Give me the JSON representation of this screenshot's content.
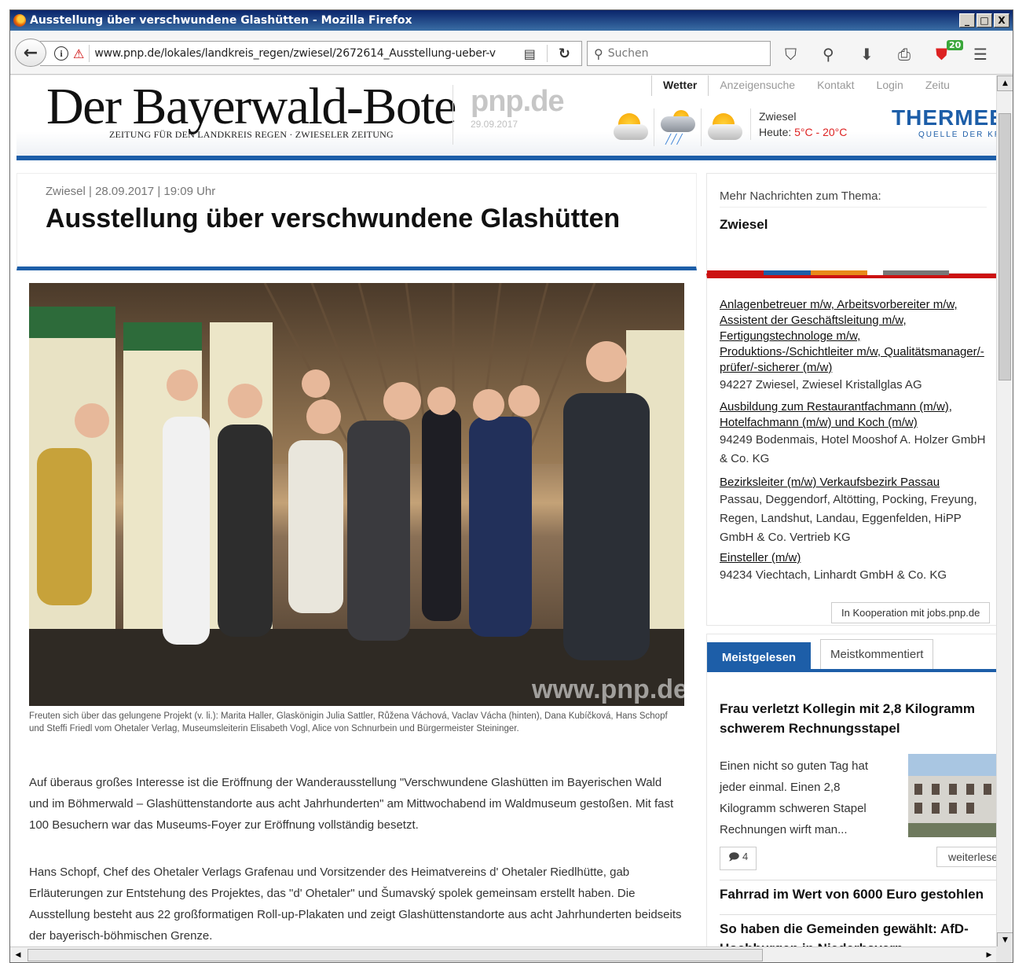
{
  "window": {
    "title": "Ausstellung über verschwundene Glashütten - Mozilla Firefox",
    "controls": [
      "_",
      "□",
      "X"
    ]
  },
  "navbar": {
    "url": "www.pnp.de/lokales/landkreis_regen/zwiesel/2672614_Ausstellung-ueber-v",
    "search_placeholder": "Suchen",
    "addon_badge": "20"
  },
  "site": {
    "logo": "Der Bayerwald-Bote",
    "logo_sub": "ZEITUNG FÜR DEN LANDKREIS REGEN · ZWIESELER ZEITUNG",
    "pnp": "pnp.de",
    "pnp_date": "29.09.2017",
    "top_tabs": [
      "Wetter",
      "Anzeigensuche",
      "Kontakt",
      "Login",
      "Zeitu"
    ],
    "weather": {
      "place": "Zwiesel",
      "today_label": "Heute: ",
      "min": "5°C",
      "dash": " - ",
      "max": "20°C",
      "icons": [
        "sun-cloud-icon",
        "rain-cloud-icon",
        "sun-cloud-icon"
      ]
    },
    "ad": {
      "brand": "THERMEE",
      "tagline": "QUELLE DER KRA"
    }
  },
  "article": {
    "meta": "Zwiesel  |  28.09.2017  |  19:09 Uhr",
    "headline": "Ausstellung über verschwundene Glashütten",
    "photo_watermark": "www.pnp.de",
    "caption": "Freuten sich über das gelungene Projekt (v. li.): Marita Haller, Glaskönigin Julia Sattler, Růžena Váchová, Vaclav Vácha (hinten), Dana Kubíčková, Hans Schopf und Steffi Friedl vom Ohetaler Verlag, Museumsleiterin Elisabeth Vogl, Alice von Schnurbein und Bürgermeister Steininger.",
    "paragraphs": [
      "Auf überaus großes Interesse ist die Eröffnung der Wanderausstellung \"Verschwundene Glashütten im Bayerischen Wald und im Böhmerwald – Glashüttenstandorte aus acht Jahrhunderten\" am Mittwochabend im Waldmuseum gestoßen. Mit fast 100 Besuchern war das Museums-Foyer zur Eröffnung vollständig besetzt.",
      "Hans Schopf, Chef des Ohetaler Verlags Grafenau und Vorsitzender des Heimatvereins d' Ohetaler Riedlhütte, gab Erläuterungen zur Entstehung des Projektes, das \"d' Ohetaler\" und Šumavský spolek gemeinsam erstellt haben. Die Ausstellung besteht aus 22 großformatigen Roll-up-Plakaten und zeigt Glashüttenstandorte aus acht Jahrhunderten beidseits der bayerisch-böhmischen Grenze."
    ]
  },
  "sidebar": {
    "more_label": "Mehr Nachrichten zum Thema:",
    "topic": "Zwiesel",
    "jobs": [
      {
        "title": "Anlagenbetreuer m/w, Arbeitsvorbereiter m/w, Assistent der Geschäftsleitung m/w, Fertigungstechnologe m/w, Produktions-/Schichtleiter m/w, Qualitätsmanager/-prüfer/-sicherer (m/w)",
        "detail": "94227 Zwiesel, Zwiesel Kristallglas AG"
      },
      {
        "title": "Ausbildung zum Restaurantfachmann (m/w), Hotelfachmann (m/w) und Koch (m/w)",
        "detail": "94249 Bodenmais, Hotel Mooshof A. Holzer GmbH & Co. KG"
      },
      {
        "title": "Bezirksleiter (m/w) Verkaufsbezirk Passau",
        "detail": "Passau, Deggendorf, Altötting, Pocking, Freyung, Regen, Landshut, Landau, Eggenfelden, HiPP GmbH & Co. Vertrieb KG"
      },
      {
        "title": "Einsteller (m/w)",
        "detail": "94234 Viechtach, Linhardt GmbH & Co. KG"
      }
    ],
    "coop": "In Kooperation mit jobs.pnp.de",
    "tabs": [
      "Meistgelesen",
      "Meistkommentiert"
    ],
    "most_read": [
      {
        "title": "Frau verletzt Kollegin mit 2,8 Kilogramm schwerem Rechnungsstapel",
        "teaser": "Einen nicht so guten Tag hat jeder einmal. Einen 2,8 Kilogramm schweren Stapel Rechnungen wirft man...",
        "comments": "4",
        "more": "weiterlesen"
      },
      {
        "title": "Fahrrad im Wert von 6000 Euro gestohlen"
      },
      {
        "title": "So haben die Gemeinden gewählt: AfD-Hochburgen in Niederbayern"
      }
    ]
  },
  "colors": {
    "brand_blue": "#1d5ea8",
    "accent_red": "#cc1111"
  }
}
